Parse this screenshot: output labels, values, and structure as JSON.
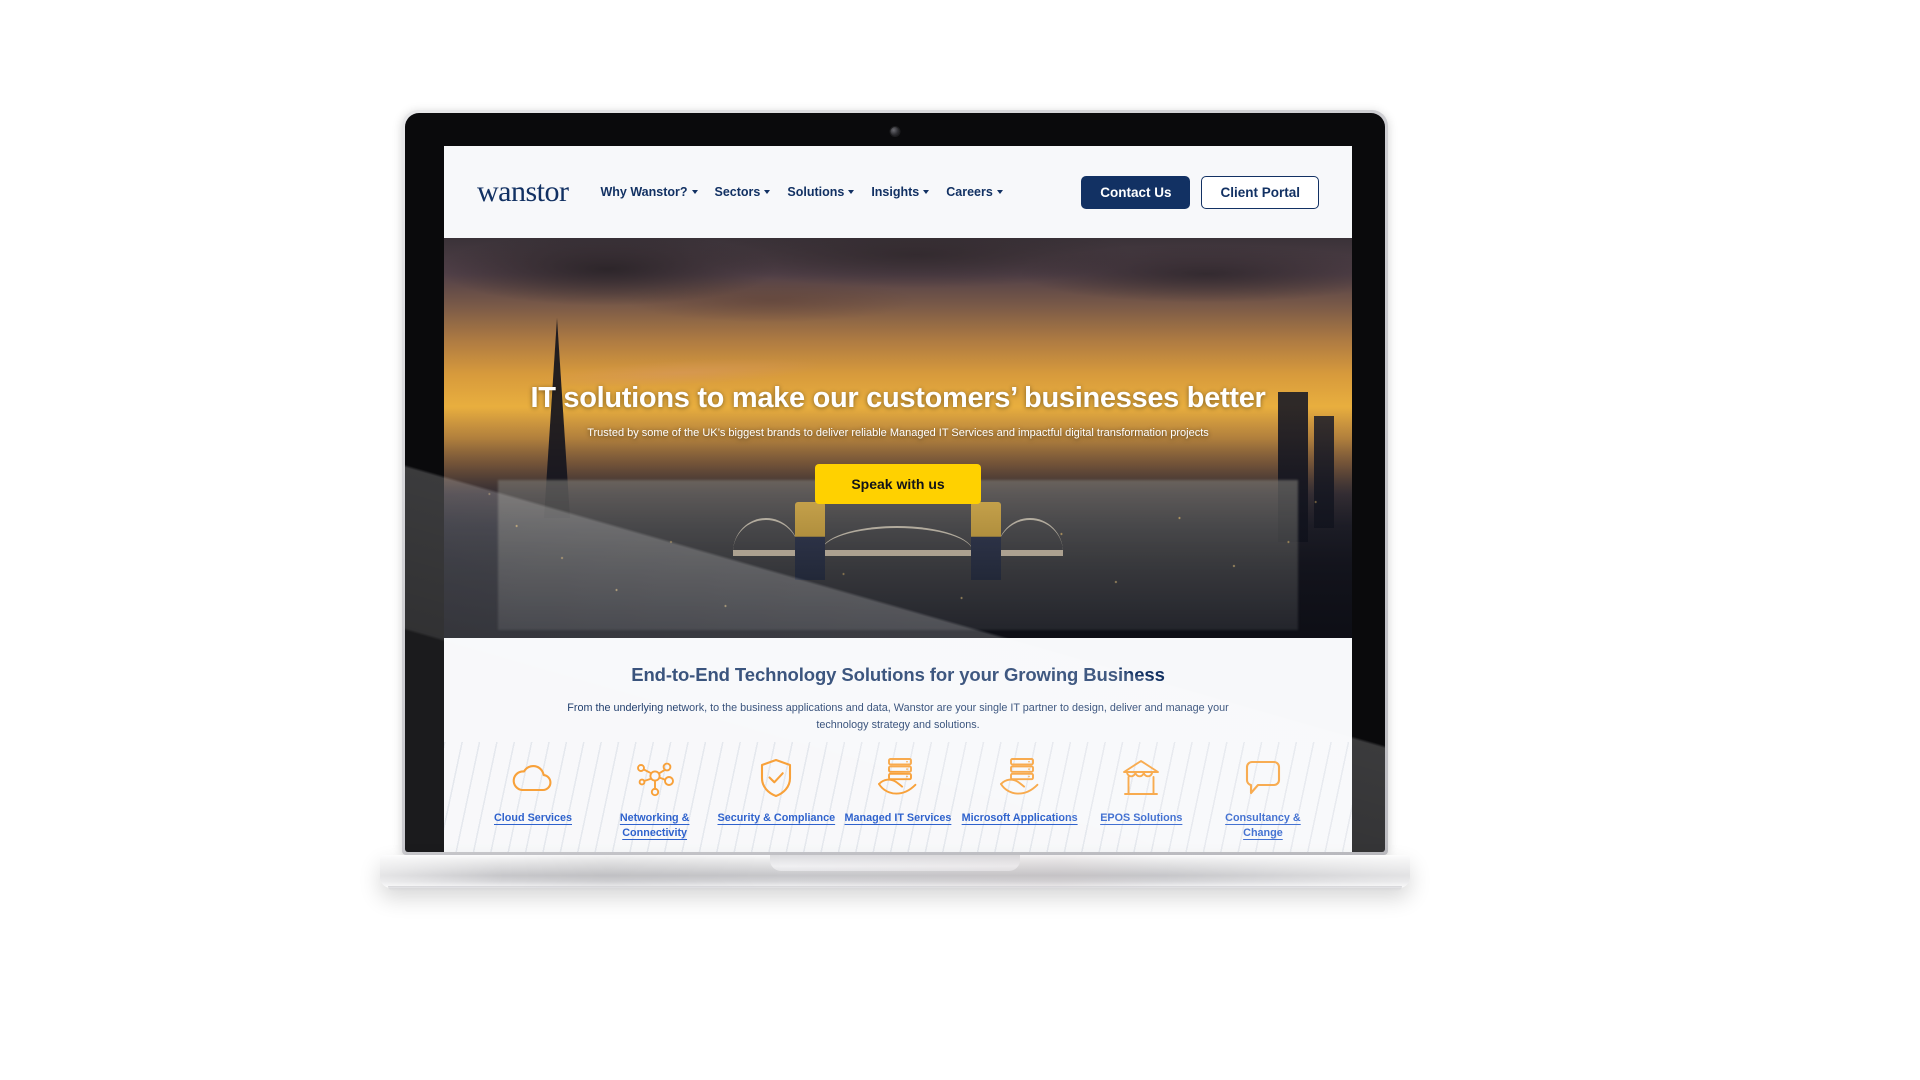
{
  "device": {
    "type": "laptop-mockup",
    "camera_icon": "webcam-icon"
  },
  "site": {
    "logo_text": "wanstor",
    "brand_navy": "#123163",
    "brand_yellow": "#FFD100",
    "brand_orange": "#F79A2B",
    "link_blue": "#1F56C9",
    "page_bg": "#f7f8fa"
  },
  "header": {
    "nav_items": [
      {
        "label": "Why Wanstor?",
        "has_dropdown": true
      },
      {
        "label": "Sectors",
        "has_dropdown": true
      },
      {
        "label": "Solutions",
        "has_dropdown": true
      },
      {
        "label": "Insights",
        "has_dropdown": true
      },
      {
        "label": "Careers",
        "has_dropdown": true
      }
    ],
    "contact_label": "Contact Us",
    "portal_label": "Client Portal"
  },
  "hero": {
    "title": "IT solutions to make our customers’ businesses better",
    "subtitle": "Trusted by some of the UK’s biggest brands to deliver reliable Managed IT Services and impactful digital transformation projects",
    "cta_label": "Speak with us",
    "background_description": "London skyline at sunset with Tower Bridge and The Shard"
  },
  "services_section": {
    "title": "End-to-End Technology Solutions for your Growing Business",
    "description": "From the underlying network, to the business applications and data, Wanstor are your single IT partner to design, deliver and manage your technology strategy and solutions.",
    "items": [
      {
        "label": "Cloud Services",
        "icon": "cloud-icon"
      },
      {
        "label": "Networking & Connectivity",
        "icon": "network-nodes-icon"
      },
      {
        "label": "Security & Compliance",
        "icon": "shield-check-icon"
      },
      {
        "label": "Managed IT Services",
        "icon": "server-hand-icon"
      },
      {
        "label": "Microsoft Applications",
        "icon": "server-hand-icon"
      },
      {
        "label": "EPOS Solutions",
        "icon": "storefront-icon"
      },
      {
        "label": "Consultancy & Change",
        "icon": "speech-bubble-icon"
      }
    ]
  }
}
